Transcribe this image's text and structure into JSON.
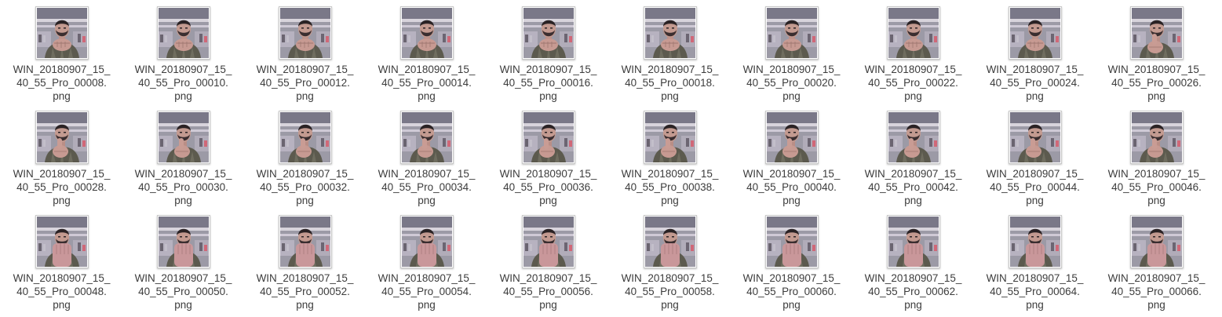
{
  "files": [
    {
      "line1": "WIN_20180907_15_",
      "line2": "40_55_Pro_00008.",
      "line3": "png",
      "pose": "fist"
    },
    {
      "line1": "WIN_20180907_15_",
      "line2": "40_55_Pro_00010.",
      "line3": "png",
      "pose": "fist"
    },
    {
      "line1": "WIN_20180907_15_",
      "line2": "40_55_Pro_00012.",
      "line3": "png",
      "pose": "fist"
    },
    {
      "line1": "WIN_20180907_15_",
      "line2": "40_55_Pro_00014.",
      "line3": "png",
      "pose": "fist"
    },
    {
      "line1": "WIN_20180907_15_",
      "line2": "40_55_Pro_00016.",
      "line3": "png",
      "pose": "fist"
    },
    {
      "line1": "WIN_20180907_15_",
      "line2": "40_55_Pro_00018.",
      "line3": "png",
      "pose": "fist"
    },
    {
      "line1": "WIN_20180907_15_",
      "line2": "40_55_Pro_00020.",
      "line3": "png",
      "pose": "fist"
    },
    {
      "line1": "WIN_20180907_15_",
      "line2": "40_55_Pro_00022.",
      "line3": "png",
      "pose": "fist"
    },
    {
      "line1": "WIN_20180907_15_",
      "line2": "40_55_Pro_00024.",
      "line3": "png",
      "pose": "fist"
    },
    {
      "line1": "WIN_20180907_15_",
      "line2": "40_55_Pro_00026.",
      "line3": "png",
      "pose": "thumb"
    },
    {
      "line1": "WIN_20180907_15_",
      "line2": "40_55_Pro_00028.",
      "line3": "png",
      "pose": "thumb"
    },
    {
      "line1": "WIN_20180907_15_",
      "line2": "40_55_Pro_00030.",
      "line3": "png",
      "pose": "thumb"
    },
    {
      "line1": "WIN_20180907_15_",
      "line2": "40_55_Pro_00032.",
      "line3": "png",
      "pose": "thumb"
    },
    {
      "line1": "WIN_20180907_15_",
      "line2": "40_55_Pro_00034.",
      "line3": "png",
      "pose": "thumb"
    },
    {
      "line1": "WIN_20180907_15_",
      "line2": "40_55_Pro_00036.",
      "line3": "png",
      "pose": "thumb"
    },
    {
      "line1": "WIN_20180907_15_",
      "line2": "40_55_Pro_00038.",
      "line3": "png",
      "pose": "thumb"
    },
    {
      "line1": "WIN_20180907_15_",
      "line2": "40_55_Pro_00040.",
      "line3": "png",
      "pose": "thumb"
    },
    {
      "line1": "WIN_20180907_15_",
      "line2": "40_55_Pro_00042.",
      "line3": "png",
      "pose": "thumb"
    },
    {
      "line1": "WIN_20180907_15_",
      "line2": "40_55_Pro_00044.",
      "line3": "png",
      "pose": "thumb"
    },
    {
      "line1": "WIN_20180907_15_",
      "line2": "40_55_Pro_00046.",
      "line3": "png",
      "pose": "thumb"
    },
    {
      "line1": "WIN_20180907_15_",
      "line2": "40_55_Pro_00048.",
      "line3": "png",
      "pose": "palm"
    },
    {
      "line1": "WIN_20180907_15_",
      "line2": "40_55_Pro_00050.",
      "line3": "png",
      "pose": "palm"
    },
    {
      "line1": "WIN_20180907_15_",
      "line2": "40_55_Pro_00052.",
      "line3": "png",
      "pose": "palm"
    },
    {
      "line1": "WIN_20180907_15_",
      "line2": "40_55_Pro_00054.",
      "line3": "png",
      "pose": "palm"
    },
    {
      "line1": "WIN_20180907_15_",
      "line2": "40_55_Pro_00056.",
      "line3": "png",
      "pose": "palm"
    },
    {
      "line1": "WIN_20180907_15_",
      "line2": "40_55_Pro_00058.",
      "line3": "png",
      "pose": "palm"
    },
    {
      "line1": "WIN_20180907_15_",
      "line2": "40_55_Pro_00060.",
      "line3": "png",
      "pose": "palm"
    },
    {
      "line1": "WIN_20180907_15_",
      "line2": "40_55_Pro_00062.",
      "line3": "png",
      "pose": "palm"
    },
    {
      "line1": "WIN_20180907_15_",
      "line2": "40_55_Pro_00064.",
      "line3": "png",
      "pose": "palm"
    },
    {
      "line1": "WIN_20180907_15_",
      "line2": "40_55_Pro_00066.",
      "line3": "png",
      "pose": "palm"
    }
  ],
  "colors": {
    "text": "#3c3c3c",
    "thumb_border": "#c9c9c9",
    "background": "#ffffff"
  }
}
